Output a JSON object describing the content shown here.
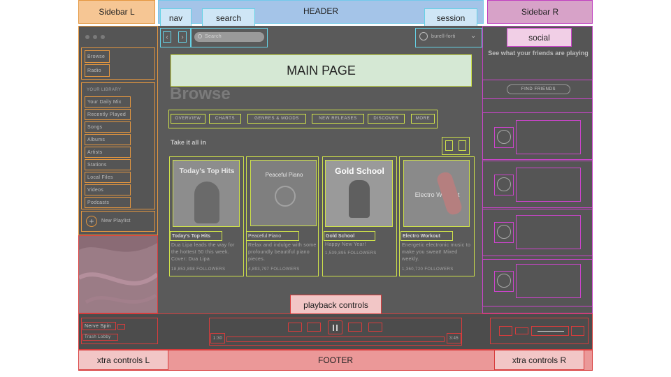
{
  "labels": {
    "sidebar_l": "Sidebar L",
    "header": "HEADER",
    "sidebar_r": "Sidebar R",
    "nav": "nav",
    "search": "search",
    "session": "session",
    "social": "social",
    "main_page": "MAIN PAGE",
    "playback_controls": "playback controls",
    "xtra_l": "xtra controls L",
    "footer": "FOOTER",
    "xtra_r": "xtra controls R"
  },
  "topbar": {
    "search_placeholder": "Search",
    "user": "burell-forti"
  },
  "sidebar": {
    "items": [
      "Browse",
      "Radio"
    ],
    "library_title": "YOUR LIBRARY",
    "library_items": [
      "Your Daily Mix",
      "Recently Played",
      "Songs",
      "Albums",
      "Artists",
      "Stations",
      "Local Files",
      "Videos",
      "Podcasts"
    ],
    "new_playlist": "New Playlist"
  },
  "main": {
    "title": "Browse",
    "tabs": [
      "OVERVIEW",
      "CHARTS",
      "GENRES & MOODS",
      "NEW RELEASES",
      "DISCOVER",
      "MORE"
    ],
    "section_title": "Take it all in",
    "cards": [
      {
        "img_title": "Today's Top Hits",
        "title": "Today's Top Hits",
        "desc": "Dua Lipa leads the way for the hottest 50 this week. Cover: Dua Lipa",
        "followers": "18,853,898 FOLLOWERS",
        "color": "#8d8d8d"
      },
      {
        "img_title": "Peaceful Piano",
        "title": "Peaceful Piano",
        "desc": "Relax and indulge with some profoundly beautiful piano pieces.",
        "followers": "4,893,797 FOLLOWERS",
        "color": "#7f7f7f"
      },
      {
        "img_title": "Gold School",
        "title": "Gold School",
        "desc": "Happy New Year!",
        "followers": "1,539,895 FOLLOWERS",
        "color": "#9a9a9a"
      },
      {
        "img_title": "Electro Workout",
        "title": "Electro Workout",
        "desc": "Energetic electronic music to make you sweat! Mixed weekly.",
        "followers": "1,360,720 FOLLOWERS",
        "color": "#8a8a8a"
      }
    ]
  },
  "social": {
    "heading": "See what your friends are playing",
    "find_friends": "FIND FRIENDS"
  },
  "player": {
    "track": "Nerve Spin",
    "artist": "Trash Lobby",
    "time_current": "1:30",
    "time_total": "3:45"
  }
}
